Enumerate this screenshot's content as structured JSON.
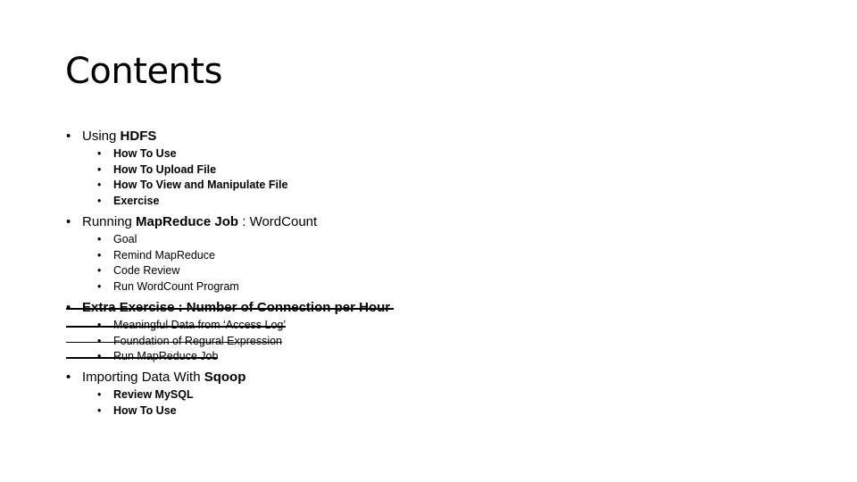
{
  "title": "Contents",
  "bullet": "•",
  "sections": [
    {
      "parts": [
        {
          "text": "Using ",
          "bold": false
        },
        {
          "text": "HDFS",
          "bold": true
        }
      ],
      "items": [
        {
          "text": "How To Use",
          "bold": true
        },
        {
          "text": "How To Upload File",
          "bold": true
        },
        {
          "text": "How To View and Manipulate File",
          "bold": true
        },
        {
          "text": "Exercise",
          "bold": true
        }
      ]
    },
    {
      "parts": [
        {
          "text": "Running ",
          "bold": false
        },
        {
          "text": "MapReduce Job",
          "bold": true
        },
        {
          "text": " : WordCount",
          "bold": false
        }
      ],
      "items": [
        {
          "text": "Goal",
          "bold": false
        },
        {
          "text": "Remind MapReduce",
          "bold": false
        },
        {
          "text": "Code Review",
          "bold": false
        },
        {
          "text": "Run WordCount Program",
          "bold": false
        }
      ]
    },
    {
      "strikethrough": true,
      "parts": [
        {
          "text": "Extra Exercise : Number of Connection per Hour",
          "bold": true
        }
      ],
      "items": [
        {
          "text": "Meaningful Data from ‘Access Log’",
          "bold": false
        },
        {
          "text": "Foundation of Regural Expression",
          "bold": false
        },
        {
          "text": "Run MapReduce Job",
          "bold": false
        }
      ]
    },
    {
      "parts": [
        {
          "text": "Importing Data With ",
          "bold": false
        },
        {
          "text": "Sqoop",
          "bold": true
        }
      ],
      "items": [
        {
          "text": "Review MySQL",
          "bold": true
        },
        {
          "text": "How To Use",
          "bold": true
        }
      ]
    }
  ]
}
